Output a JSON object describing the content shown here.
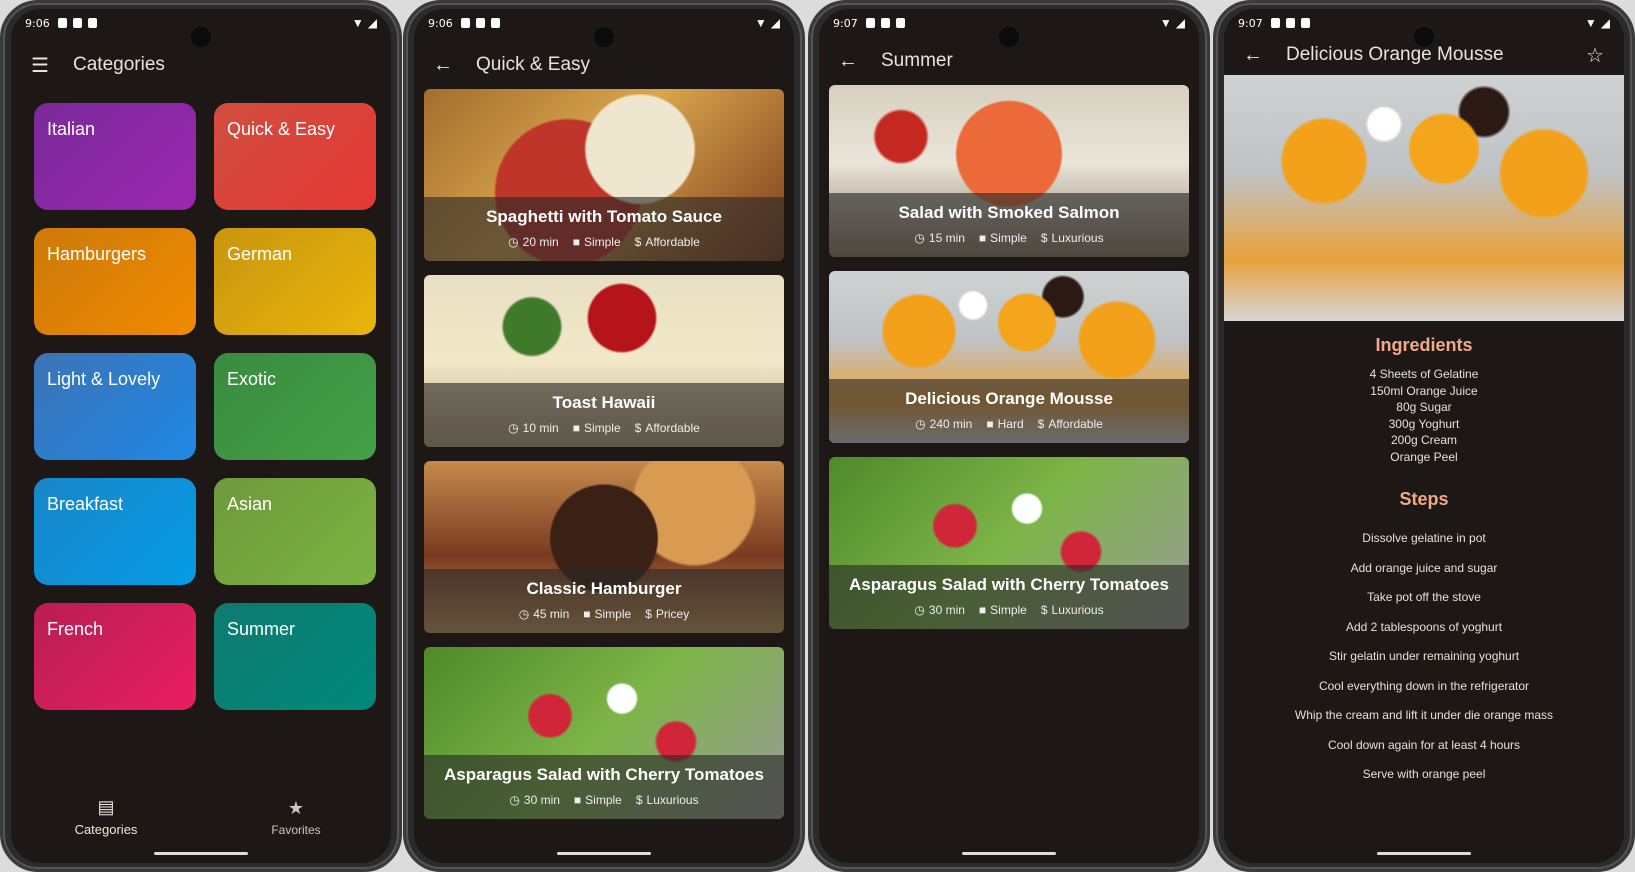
{
  "status": {
    "time_1": "9:06",
    "time_2": "9:06",
    "time_3": "9:07",
    "time_4": "9:07"
  },
  "screen1": {
    "title": "Categories",
    "categories": [
      "Italian",
      "Quick & Easy",
      "Hamburgers",
      "German",
      "Light & Lovely",
      "Exotic",
      "Breakfast",
      "Asian",
      "French",
      "Summer"
    ],
    "nav": {
      "categories": "Categories",
      "favorites": "Favorites"
    }
  },
  "screen2": {
    "title": "Quick & Easy",
    "meals": [
      {
        "title": "Spaghetti with Tomato Sauce",
        "duration": "20 min",
        "complexity": "Simple",
        "affordability": "Affordable"
      },
      {
        "title": "Toast Hawaii",
        "duration": "10 min",
        "complexity": "Simple",
        "affordability": "Affordable"
      },
      {
        "title": "Classic Hamburger",
        "duration": "45 min",
        "complexity": "Simple",
        "affordability": "Pricey"
      },
      {
        "title": "Asparagus Salad with Cherry Tomatoes",
        "duration": "30 min",
        "complexity": "Simple",
        "affordability": "Luxurious"
      }
    ]
  },
  "screen3": {
    "title": "Summer",
    "meals": [
      {
        "title": "Salad with Smoked Salmon",
        "duration": "15 min",
        "complexity": "Simple",
        "affordability": "Luxurious"
      },
      {
        "title": "Delicious Orange Mousse",
        "duration": "240 min",
        "complexity": "Hard",
        "affordability": "Affordable"
      },
      {
        "title": "Asparagus Salad with Cherry Tomatoes",
        "duration": "30 min",
        "complexity": "Simple",
        "affordability": "Luxurious"
      }
    ]
  },
  "screen4": {
    "title": "Delicious Orange Mousse",
    "ingredients_title": "Ingredients",
    "ingredients": [
      "4 Sheets of Gelatine",
      "150ml Orange Juice",
      "80g Sugar",
      "300g Yoghurt",
      "200g Cream",
      "Orange Peel"
    ],
    "steps_title": "Steps",
    "steps": [
      "Dissolve gelatine in pot",
      "Add orange juice and sugar",
      "Take pot off the stove",
      "Add 2 tablespoons of yoghurt",
      "Stir gelatin under remaining yoghurt",
      "Cool everything down in the refrigerator",
      "Whip the cream and lift it under die orange mass",
      "Cool down again for at least 4 hours",
      "Serve with orange peel"
    ]
  },
  "icons": {
    "menu": "menu-icon",
    "back": "back-arrow-icon",
    "star": "star-outline-icon",
    "clock": "clock-icon",
    "briefcase": "briefcase-icon",
    "dollar": "dollar-icon"
  }
}
